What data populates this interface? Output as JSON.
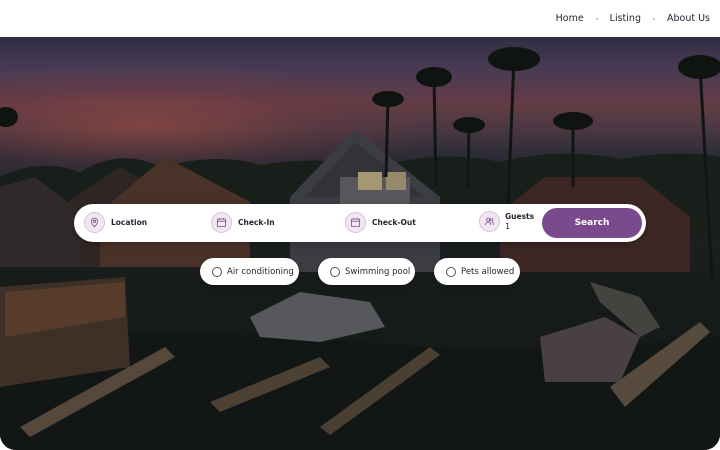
{
  "nav": {
    "links": [
      "Home",
      "Listing",
      "About Us"
    ]
  },
  "search": {
    "location_label": "Location",
    "checkin_label": "Check-In",
    "checkout_label": "Check-Out",
    "guests_label": "Guests",
    "guests_value": "1",
    "button_label": "Search"
  },
  "filters": {
    "items": [
      "Air conditioning",
      "Swimming pool",
      "Pets allowed"
    ]
  },
  "colors": {
    "accent": "#7a4a8d",
    "icon_bg": "#f1e7f2"
  },
  "icons": {
    "location": "map-pin-icon",
    "checkin": "calendar-icon",
    "checkout": "calendar-icon",
    "guests": "users-icon"
  }
}
